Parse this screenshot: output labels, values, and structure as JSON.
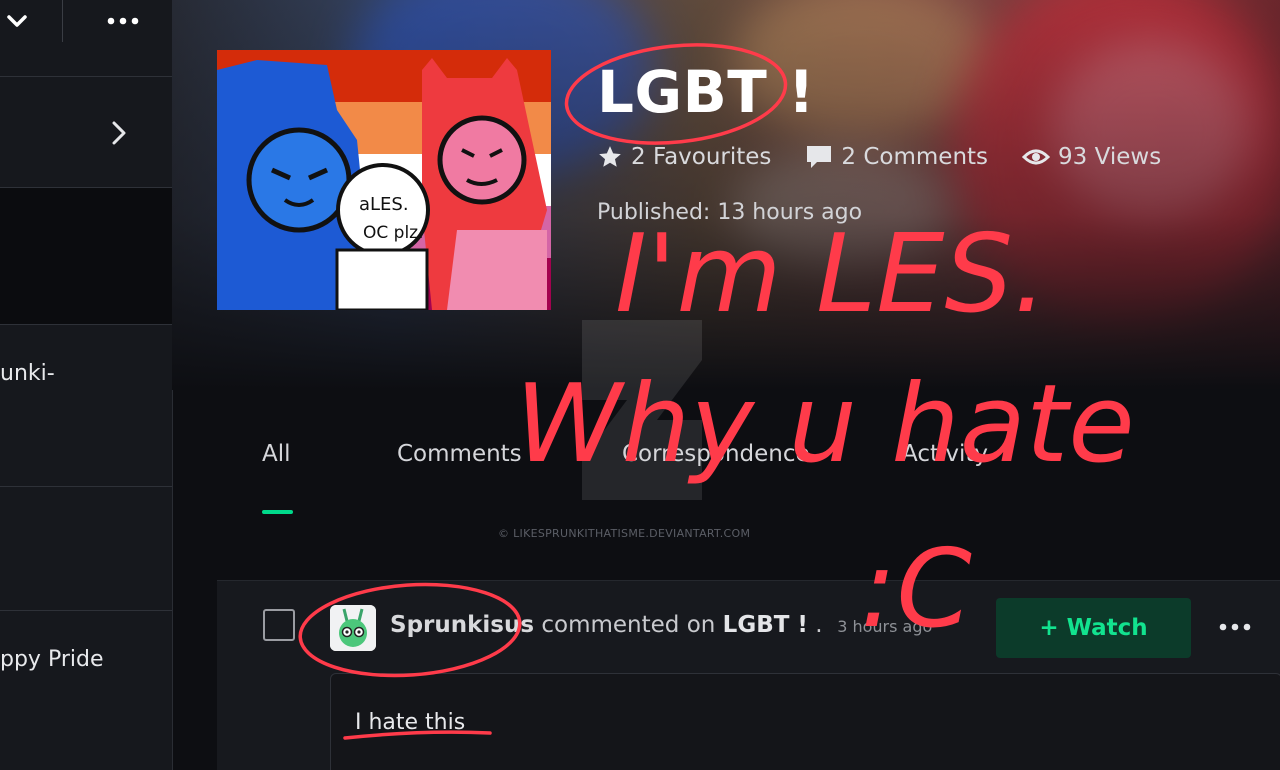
{
  "sidebar": {
    "items": [
      {
        "label": ""
      },
      {
        "label": "unki-"
      },
      {
        "label": "ppy Pride"
      }
    ]
  },
  "deviation": {
    "title": "LGBT !",
    "favourites": "2 Favourites",
    "comments": "2 Comments",
    "views": "93 Views",
    "published": "Published: 13 hours ago",
    "thumbnail_text": [
      "aLES.",
      "OC plz."
    ]
  },
  "tabs": [
    {
      "label": "All",
      "active": true
    },
    {
      "label": "Comments",
      "active": false
    },
    {
      "label": "Correspondence",
      "active": false
    },
    {
      "label": "Activity",
      "active": false
    }
  ],
  "watermark": "© LIKESPRUNKITHATISME.DEVIANTART.COM",
  "feed": {
    "item": {
      "username": "Sprunkisus",
      "action": "commented on",
      "deviation": "LGBT !",
      "time": "3 hours ago",
      "watch_label": "+ Watch",
      "comment_text": "I hate this"
    }
  },
  "annotation": {
    "line1": "I'm LES.",
    "line2": "Why u hate",
    "line3": ":C",
    "color": "#ff3b4a"
  },
  "colors": {
    "accent": "#00d98b",
    "watch_bg": "#0c3b2a",
    "watch_text": "#12e38f",
    "marker": "#ff3b4a"
  }
}
